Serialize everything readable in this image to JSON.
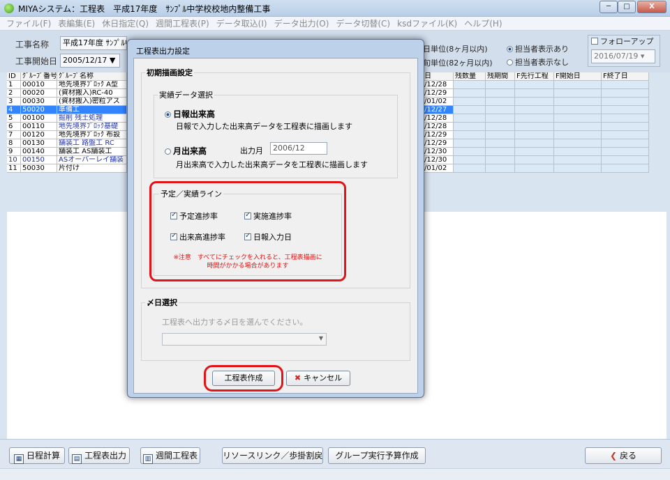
{
  "window": {
    "title": "MIYAシステム：工程表　平成17年度　ｻﾝﾌﾟﾙ中学校校地内整備工事",
    "min": "─",
    "max": "□",
    "close": "X"
  },
  "menu": [
    "ファイル(F)",
    "表編集(E)",
    "休日指定(Q)",
    "週間工程表(P)",
    "データ取込(I)",
    "データ出力(O)",
    "データ切替(C)",
    "ksdファイル(K)",
    "ヘルプ(H)"
  ],
  "header": {
    "project_label": "工事名称",
    "project_value": "平成17年度 ｻﾝﾌﾟﾙ中",
    "start_label": "工事開始日",
    "start_value": "2005/12/17",
    "unit1": "日単位(8ヶ月以内)",
    "unit2": "旬単位(82ヶ月以内)",
    "assignee_on": "担当者表示あり",
    "assignee_off": "担当者表示なし",
    "followup_label": "フォローアップ",
    "followup_date": "2016/07/19"
  },
  "grid": {
    "headers": [
      "ID",
      "ｸﾞﾙｰﾌﾟ番号",
      "ｸﾞﾙｰﾌﾟ名称",
      "日",
      "残数量",
      "残期間",
      "F先行工程",
      "F開始日",
      "F終了日"
    ],
    "rows": [
      {
        "id": "1",
        "no": "00010",
        "name": "地先境界ﾌﾞﾛｯｸ A型",
        "date": "/12/28"
      },
      {
        "id": "2",
        "no": "00020",
        "name": "(資材搬入)RC-40",
        "date": "/12/29"
      },
      {
        "id": "3",
        "no": "00030",
        "name": "(資材搬入)密粒アス",
        "date": "/01/02"
      },
      {
        "id": "4",
        "no": "50020",
        "name": "準備工",
        "date": "/12/27"
      },
      {
        "id": "5",
        "no": "00100",
        "name": "掘削 残土処理",
        "date": "/12/28"
      },
      {
        "id": "6",
        "no": "00110",
        "name": "地先境界ﾌﾞﾛｯｸ基礎",
        "date": "/12/28"
      },
      {
        "id": "7",
        "no": "00120",
        "name": "地先境界ﾌﾞﾛｯｸ 布設",
        "date": "/12/29"
      },
      {
        "id": "8",
        "no": "00130",
        "name": "舗装工 路盤工 RC",
        "date": "/12/29"
      },
      {
        "id": "9",
        "no": "00140",
        "name": "舗装工 AS舗装工",
        "date": "/12/30"
      },
      {
        "id": "10",
        "no": "00150",
        "name": "ASオーバーレイ舗装",
        "date": "/12/30"
      },
      {
        "id": "11",
        "no": "50030",
        "name": "片付け",
        "date": "/01/02"
      }
    ]
  },
  "dialog": {
    "title": "工程表出力設定",
    "initial_group": "初期描画設定",
    "actual_group": "実績データ選択",
    "opt_daily": "日報出来高",
    "opt_daily_desc": "日報で入力した出来高データを工程表に描画します",
    "opt_monthly": "月出来高",
    "output_month_label": "出力月",
    "output_month_value": "2006/12",
    "opt_monthly_desc": "月出来高で入力した出来高データを工程表に描画します",
    "line_group": "予定／実績ライン",
    "chk_planned": "予定進捗率",
    "chk_actual": "実施進捗率",
    "chk_output": "出来高進捗率",
    "chk_daily_date": "日報入力日",
    "warning_1": "※注意　すべてにチェックを入れると、工程表描画に",
    "warning_2": "時間がかかる場合があります",
    "cutoff_group": "〆日選択",
    "cutoff_desc": "工程表へ出力する〆日を選んでください。",
    "create_button": "工程表作成",
    "cancel_button": "キャンセル"
  },
  "toolbar": {
    "schedule_calc": "日程計算",
    "schedule_output": "工程表出力",
    "weekly": "週間工程表",
    "resource": "リソースリンク／歩掛割戻",
    "budget": "グループ実行予算作成",
    "back": "戻る"
  },
  "colors": {
    "accent_red": "#e1141a",
    "selection_blue": "#3385ff",
    "dialog_frame": "#bdd2ea"
  }
}
